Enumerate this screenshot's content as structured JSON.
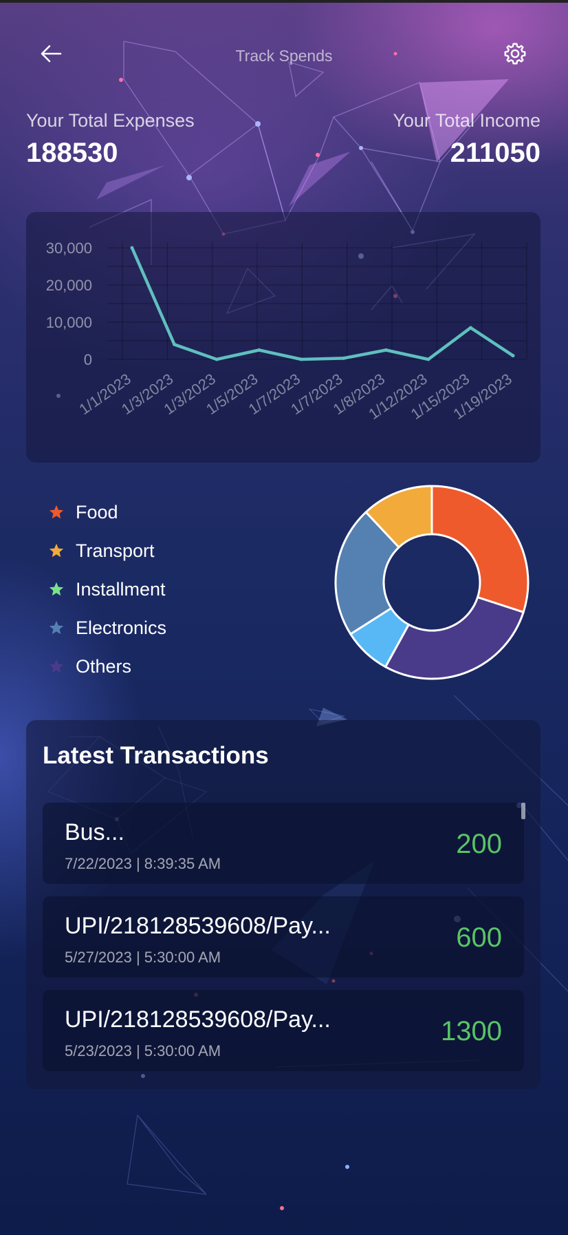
{
  "header": {
    "title": "Track Spends",
    "back_icon": "arrow-left-icon",
    "settings_icon": "gear-icon"
  },
  "summary": {
    "expenses_label": "Your Total Expenses",
    "expenses_value": "188530",
    "income_label": "Your Total Income",
    "income_value": "211050"
  },
  "chart_data": {
    "type": "line",
    "title": "",
    "xlabel": "",
    "ylabel": "",
    "x": [
      "1/1/2023",
      "1/3/2023",
      "1/3/2023",
      "1/5/2023",
      "1/7/2023",
      "1/7/2023",
      "1/8/2023",
      "1/12/2023",
      "1/15/2023",
      "1/19/2023"
    ],
    "series": [
      {
        "values": [
          30000,
          4000,
          0,
          2500,
          0,
          300,
          2500,
          0,
          8500,
          1000
        ],
        "color": "#5fbfbf"
      }
    ],
    "y_ticks": [
      "0",
      "10,000",
      "20,000",
      "30,000"
    ],
    "ylim": [
      0,
      30000
    ],
    "grid": true
  },
  "categories": {
    "items": [
      {
        "label": "Food",
        "color": "#ee5a2c",
        "share": 0.3
      },
      {
        "label": "Transport",
        "color": "#f2aa3a",
        "share": 0.12
      },
      {
        "label": "Installment",
        "color": "#7be38a",
        "share": 0.0
      },
      {
        "label": "Electronics",
        "color": "#5580b2",
        "share": 0.22
      },
      {
        "label": "Others",
        "color": "#4a3a8a",
        "share": 0.28
      }
    ],
    "extra_slice": {
      "color": "#58b8f5",
      "share": 0.08
    },
    "star_icon": "star-icon"
  },
  "transactions": {
    "title": "Latest Transactions",
    "items": [
      {
        "name": "Bus...",
        "date": "7/22/2023 | 8:39:35 AM",
        "amount": "200"
      },
      {
        "name": "UPI/218128539608/Pay...",
        "date": "5/27/2023 | 5:30:00 AM",
        "amount": "600"
      },
      {
        "name": "UPI/218128539608/Pay...",
        "date": "5/23/2023 | 5:30:00 AM",
        "amount": "1300"
      }
    ]
  }
}
